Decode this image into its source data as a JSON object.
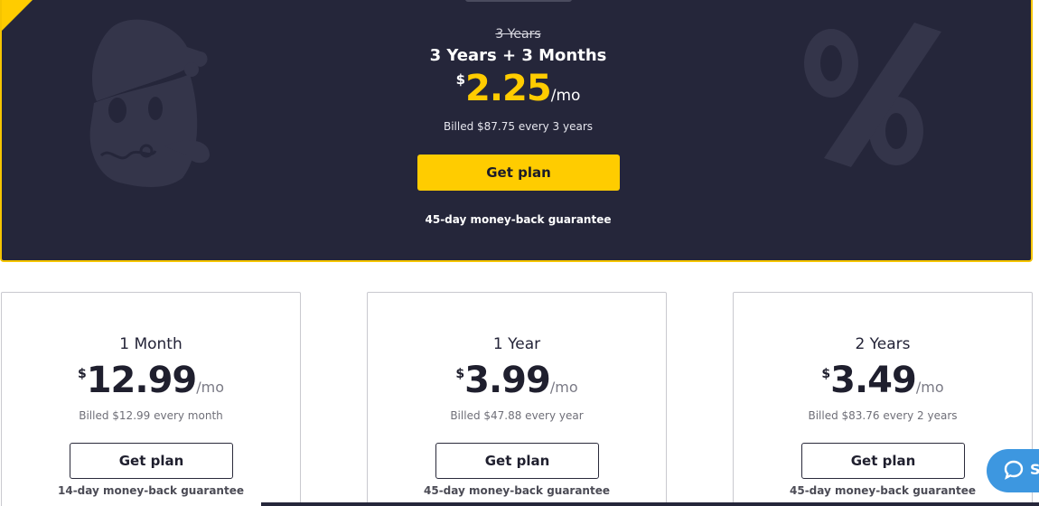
{
  "featured": {
    "old_term": "3 Years",
    "title": "3 Years + 3 Months",
    "currency": "$",
    "price": "2.25",
    "per": "/mo",
    "billed": "Billed $87.75 every 3 years",
    "button": "Get plan",
    "guarantee": "45-day money-back guarantee"
  },
  "plans": [
    {
      "title": "1 Month",
      "currency": "$",
      "price": "12.99",
      "per": "/mo",
      "billed": "Billed $12.99 every month",
      "button": "Get plan",
      "guarantee": "14-day money-back guarantee"
    },
    {
      "title": "1 Year",
      "currency": "$",
      "price": "3.99",
      "per": "/mo",
      "billed": "Billed $47.88 every year",
      "button": "Get plan",
      "guarantee": "45-day money-back guarantee"
    },
    {
      "title": "2 Years",
      "currency": "$",
      "price": "3.49",
      "per": "/mo",
      "billed": "Billed $83.76 every 2 years",
      "button": "Get plan",
      "guarantee": "45-day money-back guarantee"
    }
  ],
  "chat": {
    "icon": "chat-bubble-icon",
    "label": "S"
  },
  "colors": {
    "featured_bg": "#25263a",
    "accent_yellow": "#ffcc00",
    "chat_blue": "#3d97e0"
  }
}
